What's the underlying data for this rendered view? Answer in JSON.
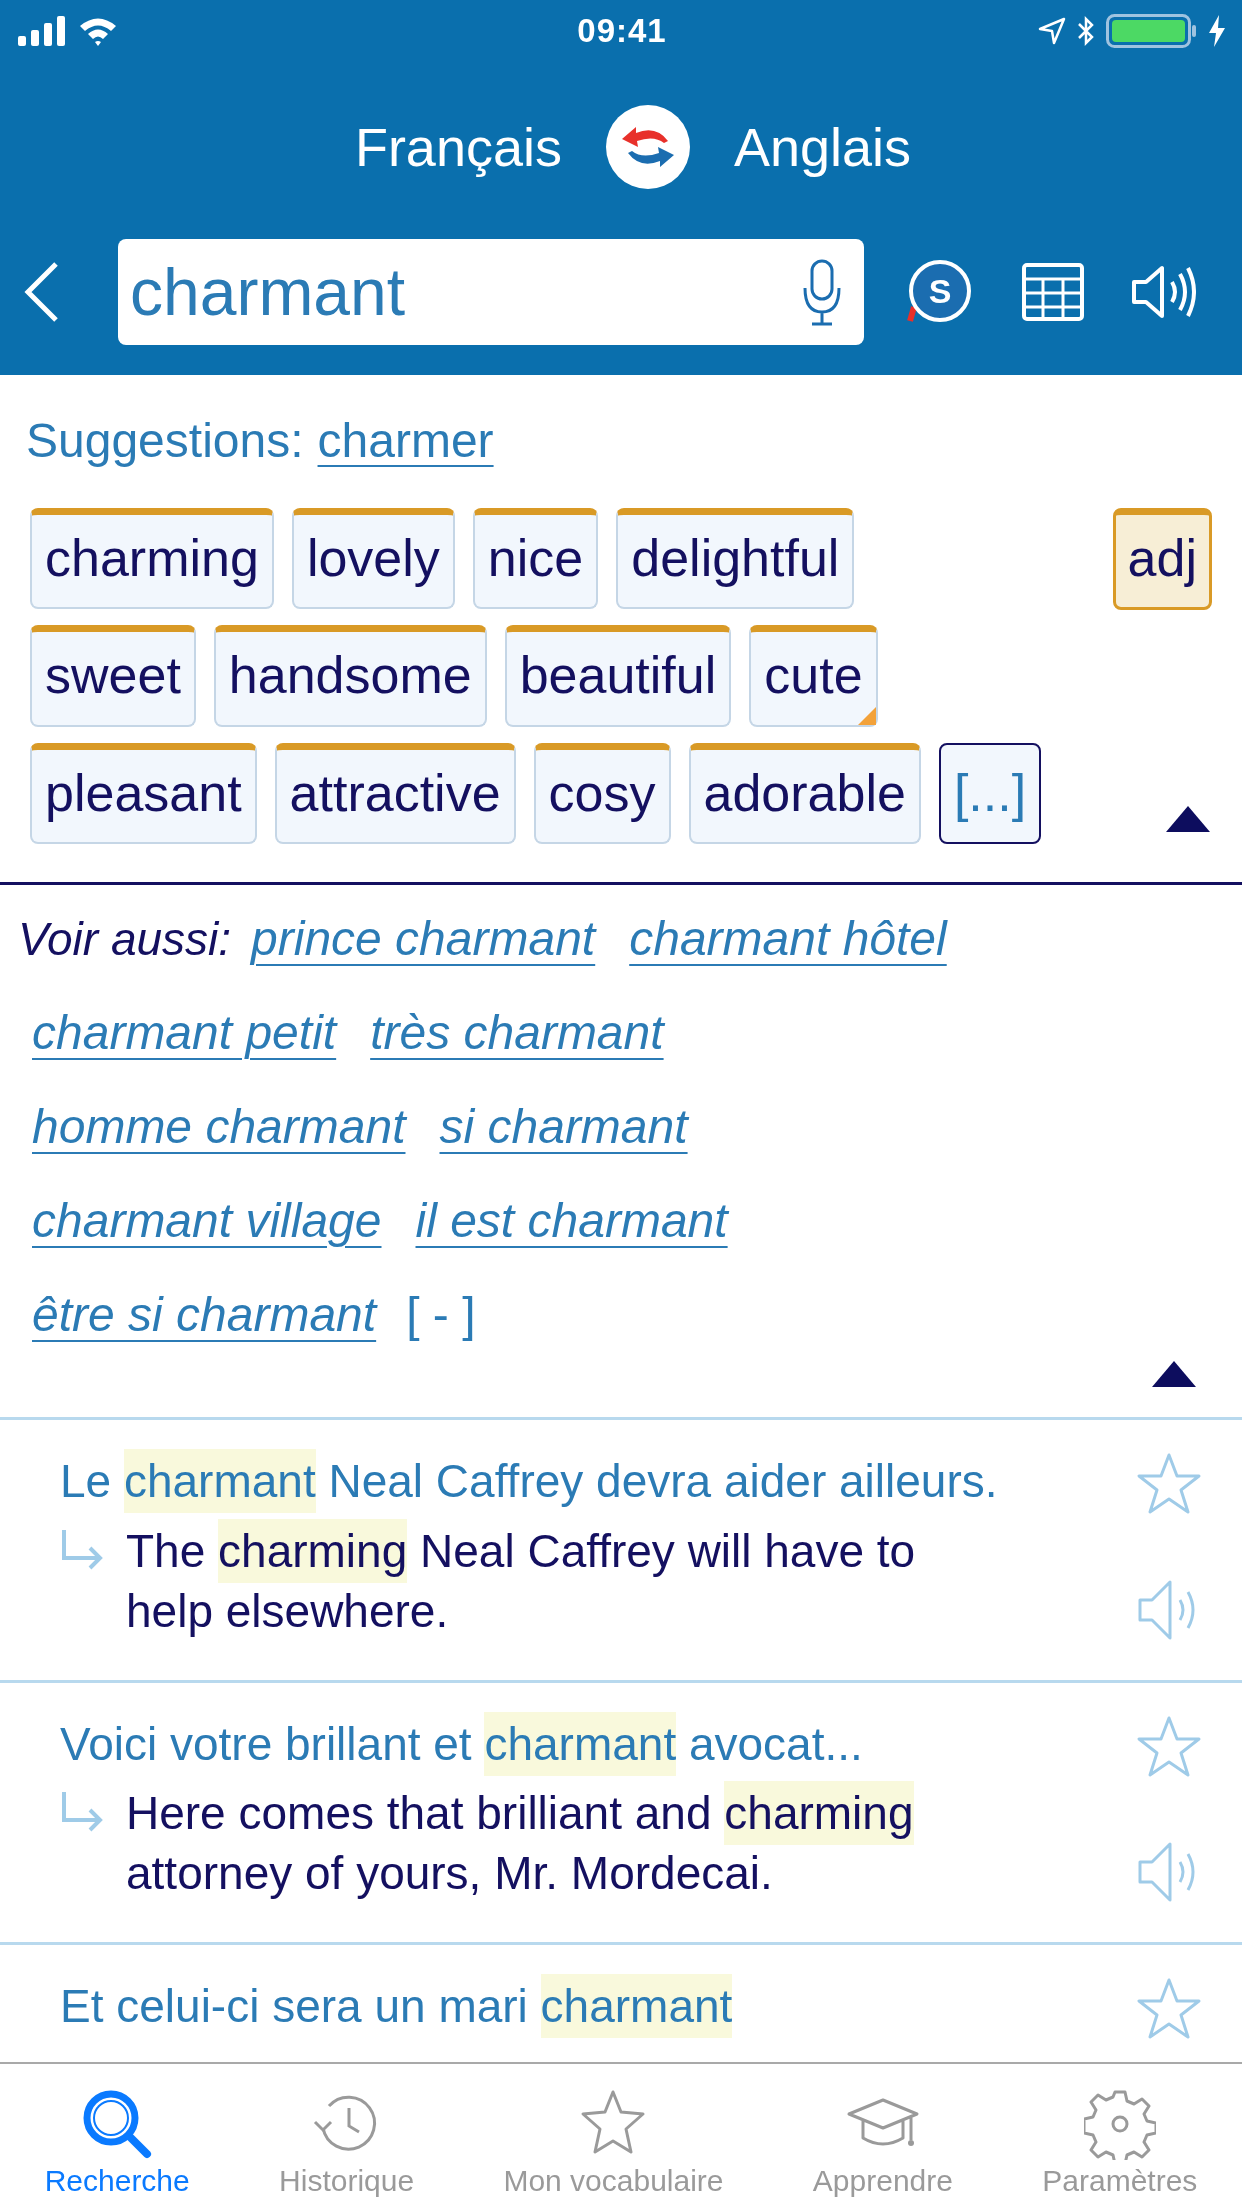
{
  "status_bar": {
    "time": "09:41"
  },
  "languages": {
    "source": "Français",
    "target": "Anglais"
  },
  "search": {
    "value": "charmant"
  },
  "header_buttons": {
    "dictionary_letter": "S"
  },
  "suggestions": {
    "label": "Suggestions:",
    "link": "charmer"
  },
  "translations": [
    {
      "label": "charming",
      "corner_mark": false
    },
    {
      "label": "lovely",
      "corner_mark": false
    },
    {
      "label": "nice",
      "corner_mark": false
    },
    {
      "label": "delightful",
      "corner_mark": false
    },
    {
      "label": "sweet",
      "corner_mark": false
    },
    {
      "label": "handsome",
      "corner_mark": false
    },
    {
      "label": "beautiful",
      "corner_mark": false
    },
    {
      "label": "cute",
      "corner_mark": true
    },
    {
      "label": "pleasant",
      "corner_mark": false
    },
    {
      "label": "attractive",
      "corner_mark": false
    },
    {
      "label": "cosy",
      "corner_mark": false
    },
    {
      "label": "adorable",
      "corner_mark": false
    }
  ],
  "more_button": "[...]",
  "part_of_speech": {
    "label": "adj",
    "selected": true
  },
  "see_also": {
    "label": "Voir aussi:",
    "rows": [
      [
        "prince charmant",
        "charmant hôtel"
      ],
      [
        "charmant petit",
        "très charmant"
      ],
      [
        "homme charmant",
        "si charmant"
      ],
      [
        "charmant village",
        "il est charmant"
      ],
      [
        "être si charmant"
      ]
    ],
    "collapse": "[ - ]"
  },
  "examples": [
    {
      "source": [
        {
          "text": "Le ",
          "highlight": false
        },
        {
          "text": "charmant",
          "highlight": true
        },
        {
          "text": " Neal Caffrey devra aider ailleurs.",
          "highlight": false
        }
      ],
      "translation": [
        {
          "text": "The ",
          "highlight": false
        },
        {
          "text": "charming",
          "highlight": true
        },
        {
          "text": " Neal Caffrey will have to help elsewhere.",
          "highlight": false
        }
      ]
    },
    {
      "source": [
        {
          "text": "Voici votre brillant et ",
          "highlight": false
        },
        {
          "text": "charmant",
          "highlight": true
        },
        {
          "text": " avocat...",
          "highlight": false
        }
      ],
      "translation": [
        {
          "text": "Here comes that brilliant and ",
          "highlight": false
        },
        {
          "text": "charming",
          "highlight": true
        },
        {
          "text": " attorney of yours, Mr. Mordecai.",
          "highlight": false
        }
      ]
    },
    {
      "source": [
        {
          "text": "Et celui-ci sera un mari ",
          "highlight": false
        },
        {
          "text": "charmant",
          "highlight": true
        }
      ]
    }
  ],
  "tab_bar": [
    {
      "label": "Recherche",
      "kind": "search",
      "selected": true
    },
    {
      "label": "Historique",
      "kind": "history",
      "selected": false
    },
    {
      "label": "Mon vocabulaire",
      "kind": "vocabulary",
      "selected": false
    },
    {
      "label": "Apprendre",
      "kind": "learn",
      "selected": false
    },
    {
      "label": "Paramètres",
      "kind": "settings",
      "selected": false
    }
  ]
}
